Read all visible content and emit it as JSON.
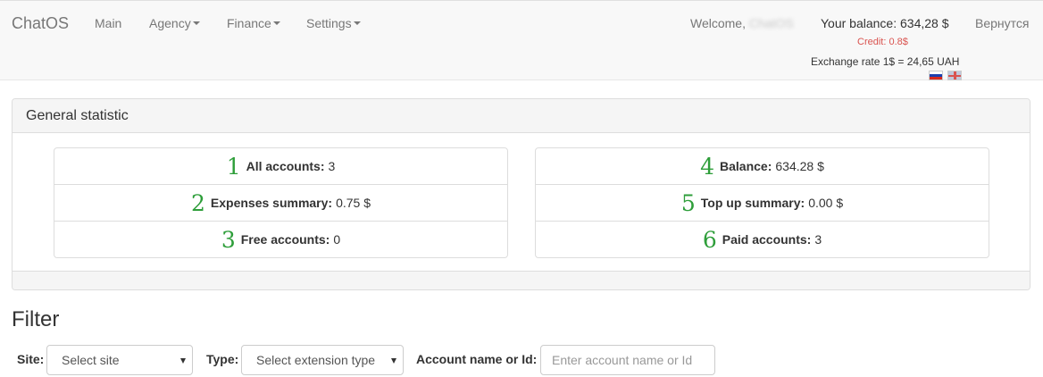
{
  "navbar": {
    "brand": "ChatOS",
    "items": [
      {
        "label": "Main"
      },
      {
        "label": "Agency"
      },
      {
        "label": "Finance"
      },
      {
        "label": "Settings"
      }
    ],
    "welcome_label": "Welcome,",
    "welcome_user": "ChatOS",
    "balance_text": "Your balance: 634,28 $",
    "credit_text": "Credit: 0.8$",
    "exchange_rate_text": "Exchange rate 1$ = 24,65 UAH",
    "logout_label": "Вернутся",
    "flags": [
      "russian-flag-icon",
      "uk-flag-icon"
    ]
  },
  "panel": {
    "title": "General statistic",
    "left_stats": [
      {
        "num": "1",
        "label": "All accounts:",
        "value": "3"
      },
      {
        "num": "2",
        "label": "Expenses summary:",
        "value": "0.75 $"
      },
      {
        "num": "3",
        "label": "Free accounts:",
        "value": "0"
      }
    ],
    "right_stats": [
      {
        "num": "4",
        "label": "Balance:",
        "value": "634.28 $"
      },
      {
        "num": "5",
        "label": "Top up summary:",
        "value": "0.00 $"
      },
      {
        "num": "6",
        "label": "Paid accounts:",
        "value": "3"
      }
    ]
  },
  "filter": {
    "title": "Filter",
    "site_label": "Site:",
    "site_value": "Select site",
    "type_label": "Type:",
    "type_value": "Select extension type",
    "account_label": "Account name or Id:",
    "account_placeholder": "Enter account name or Id"
  },
  "colors": {
    "number_accent": "#2e9e3a",
    "credit": "#d9534f"
  }
}
